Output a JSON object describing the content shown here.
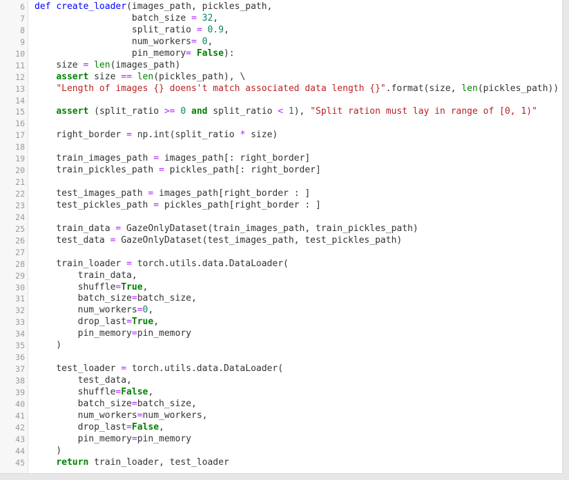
{
  "editor": {
    "lines": [
      {
        "num": "6",
        "tokens": [
          [
            "def",
            "def"
          ],
          [
            "t",
            " "
          ],
          [
            "fn",
            "create_loader"
          ],
          [
            "t",
            "(images_path, pickles_path,"
          ]
        ]
      },
      {
        "num": "7",
        "tokens": [
          [
            "t",
            "                  batch_size "
          ],
          [
            "op",
            "="
          ],
          [
            "t",
            " "
          ],
          [
            "num",
            "32"
          ],
          [
            "t",
            ","
          ]
        ]
      },
      {
        "num": "8",
        "tokens": [
          [
            "t",
            "                  split_ratio "
          ],
          [
            "op",
            "="
          ],
          [
            "t",
            " "
          ],
          [
            "num",
            "0.9"
          ],
          [
            "t",
            ","
          ]
        ]
      },
      {
        "num": "9",
        "tokens": [
          [
            "t",
            "                  num_workers"
          ],
          [
            "op",
            "="
          ],
          [
            "t",
            " "
          ],
          [
            "num",
            "0"
          ],
          [
            "t",
            ","
          ]
        ]
      },
      {
        "num": "10",
        "tokens": [
          [
            "t",
            "                  pin_memory"
          ],
          [
            "op",
            "="
          ],
          [
            "t",
            " "
          ],
          [
            "cst",
            "False"
          ],
          [
            "t",
            "):"
          ]
        ]
      },
      {
        "num": "11",
        "tokens": [
          [
            "t",
            "    size "
          ],
          [
            "op",
            "="
          ],
          [
            "t",
            " "
          ],
          [
            "bi",
            "len"
          ],
          [
            "t",
            "(images_path)"
          ]
        ]
      },
      {
        "num": "12",
        "tokens": [
          [
            "t",
            "    "
          ],
          [
            "kw",
            "assert"
          ],
          [
            "t",
            " size "
          ],
          [
            "op",
            "=="
          ],
          [
            "t",
            " "
          ],
          [
            "bi",
            "len"
          ],
          [
            "t",
            "(pickles_path), \\"
          ]
        ]
      },
      {
        "num": "13",
        "tokens": [
          [
            "t",
            "    "
          ],
          [
            "str",
            "\"Length of images {} doens't match associated data length {}\""
          ],
          [
            "t",
            ".format(size, "
          ],
          [
            "bi",
            "len"
          ],
          [
            "t",
            "(pickles_path))"
          ]
        ]
      },
      {
        "num": "14",
        "tokens": []
      },
      {
        "num": "15",
        "tokens": [
          [
            "t",
            "    "
          ],
          [
            "kw",
            "assert"
          ],
          [
            "t",
            " (split_ratio "
          ],
          [
            "op",
            ">="
          ],
          [
            "t",
            " "
          ],
          [
            "num",
            "0"
          ],
          [
            "t",
            " "
          ],
          [
            "kw",
            "and"
          ],
          [
            "t",
            " split_ratio "
          ],
          [
            "op",
            "<"
          ],
          [
            "t",
            " "
          ],
          [
            "num",
            "1"
          ],
          [
            "t",
            "), "
          ],
          [
            "str",
            "\"Split ration must lay in range of [0, 1)\""
          ]
        ]
      },
      {
        "num": "16",
        "tokens": []
      },
      {
        "num": "17",
        "tokens": [
          [
            "t",
            "    right_border "
          ],
          [
            "op",
            "="
          ],
          [
            "t",
            " np.int(split_ratio "
          ],
          [
            "op",
            "*"
          ],
          [
            "t",
            " size)"
          ]
        ]
      },
      {
        "num": "18",
        "tokens": []
      },
      {
        "num": "19",
        "tokens": [
          [
            "t",
            "    train_images_path "
          ],
          [
            "op",
            "="
          ],
          [
            "t",
            " images_path[: right_border]"
          ]
        ]
      },
      {
        "num": "20",
        "tokens": [
          [
            "t",
            "    train_pickles_path "
          ],
          [
            "op",
            "="
          ],
          [
            "t",
            " pickles_path[: right_border]"
          ]
        ]
      },
      {
        "num": "21",
        "tokens": []
      },
      {
        "num": "22",
        "tokens": [
          [
            "t",
            "    test_images_path "
          ],
          [
            "op",
            "="
          ],
          [
            "t",
            " images_path[right_border : ]"
          ]
        ]
      },
      {
        "num": "23",
        "tokens": [
          [
            "t",
            "    test_pickles_path "
          ],
          [
            "op",
            "="
          ],
          [
            "t",
            " pickles_path[right_border : ]"
          ]
        ]
      },
      {
        "num": "24",
        "tokens": []
      },
      {
        "num": "25",
        "tokens": [
          [
            "t",
            "    train_data "
          ],
          [
            "op",
            "="
          ],
          [
            "t",
            " GazeOnlyDataset(train_images_path, train_pickles_path)"
          ]
        ]
      },
      {
        "num": "26",
        "tokens": [
          [
            "t",
            "    test_data "
          ],
          [
            "op",
            "="
          ],
          [
            "t",
            " GazeOnlyDataset(test_images_path, test_pickles_path)"
          ]
        ]
      },
      {
        "num": "27",
        "tokens": []
      },
      {
        "num": "28",
        "tokens": [
          [
            "t",
            "    train_loader "
          ],
          [
            "op",
            "="
          ],
          [
            "t",
            " torch.utils.data.DataLoader("
          ]
        ]
      },
      {
        "num": "29",
        "tokens": [
          [
            "t",
            "        train_data,"
          ]
        ]
      },
      {
        "num": "30",
        "tokens": [
          [
            "t",
            "        shuffle"
          ],
          [
            "op",
            "="
          ],
          [
            "cst",
            "True"
          ],
          [
            "t",
            ","
          ]
        ]
      },
      {
        "num": "31",
        "tokens": [
          [
            "t",
            "        batch_size"
          ],
          [
            "op",
            "="
          ],
          [
            "t",
            "batch_size,"
          ]
        ]
      },
      {
        "num": "32",
        "tokens": [
          [
            "t",
            "        num_workers"
          ],
          [
            "op",
            "="
          ],
          [
            "num",
            "0"
          ],
          [
            "t",
            ","
          ]
        ]
      },
      {
        "num": "33",
        "tokens": [
          [
            "t",
            "        drop_last"
          ],
          [
            "op",
            "="
          ],
          [
            "cst",
            "True"
          ],
          [
            "t",
            ","
          ]
        ]
      },
      {
        "num": "34",
        "tokens": [
          [
            "t",
            "        pin_memory"
          ],
          [
            "op",
            "="
          ],
          [
            "t",
            "pin_memory"
          ]
        ]
      },
      {
        "num": "35",
        "tokens": [
          [
            "t",
            "    )"
          ]
        ]
      },
      {
        "num": "36",
        "tokens": []
      },
      {
        "num": "37",
        "tokens": [
          [
            "t",
            "    test_loader "
          ],
          [
            "op",
            "="
          ],
          [
            "t",
            " torch.utils.data.DataLoader("
          ]
        ]
      },
      {
        "num": "38",
        "tokens": [
          [
            "t",
            "        test_data,"
          ]
        ]
      },
      {
        "num": "39",
        "tokens": [
          [
            "t",
            "        shuffle"
          ],
          [
            "op",
            "="
          ],
          [
            "cst",
            "False"
          ],
          [
            "t",
            ","
          ]
        ]
      },
      {
        "num": "40",
        "tokens": [
          [
            "t",
            "        batch_size"
          ],
          [
            "op",
            "="
          ],
          [
            "t",
            "batch_size,"
          ]
        ]
      },
      {
        "num": "41",
        "tokens": [
          [
            "t",
            "        num_workers"
          ],
          [
            "op",
            "="
          ],
          [
            "t",
            "num_workers,"
          ]
        ]
      },
      {
        "num": "42",
        "tokens": [
          [
            "t",
            "        drop_last"
          ],
          [
            "op",
            "="
          ],
          [
            "cst",
            "False"
          ],
          [
            "t",
            ","
          ]
        ]
      },
      {
        "num": "43",
        "tokens": [
          [
            "t",
            "        pin_memory"
          ],
          [
            "op",
            "="
          ],
          [
            "t",
            "pin_memory"
          ]
        ]
      },
      {
        "num": "44",
        "tokens": [
          [
            "t",
            "    )"
          ]
        ]
      },
      {
        "num": "45",
        "tokens": [
          [
            "t",
            "    "
          ],
          [
            "kw",
            "return"
          ],
          [
            "t",
            " train_loader, test_loader"
          ]
        ]
      }
    ]
  }
}
